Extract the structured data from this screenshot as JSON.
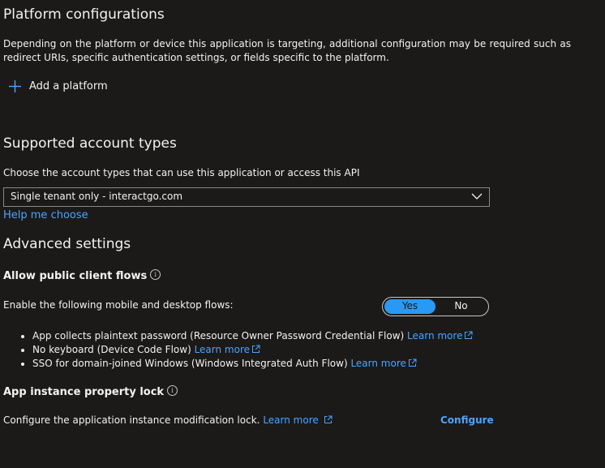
{
  "platform": {
    "title": "Platform configurations",
    "description": "Depending on the platform or device this application is targeting, additional configuration may be required such as redirect URIs, specific authentication settings, or fields specific to the platform.",
    "add_label": "Add a platform",
    "add_icon": "plus-icon"
  },
  "account_types": {
    "title": "Supported account types",
    "prompt": "Choose the account types that can use this application or access this API",
    "selected": "Single tenant only - interactgo.com",
    "help_link": "Help me choose"
  },
  "advanced": {
    "title": "Advanced settings",
    "public_client": {
      "label": "Allow public client flows",
      "prompt": "Enable the following mobile and desktop flows:",
      "toggle_yes": "Yes",
      "toggle_no": "No",
      "toggle_value": "Yes",
      "flows": [
        {
          "text": "App collects plaintext password (Resource Owner Password Credential Flow)",
          "link": "Learn more"
        },
        {
          "text": "No keyboard (Device Code Flow)",
          "link": "Learn more"
        },
        {
          "text": "SSO for domain-joined Windows (Windows Integrated Auth Flow)",
          "link": "Learn more"
        }
      ]
    },
    "property_lock": {
      "label": "App instance property lock",
      "text": "Configure the application instance modification lock.",
      "link": "Learn more",
      "configure": "Configure"
    }
  },
  "colors": {
    "background": "#1b1a19",
    "text": "#f3f2f1",
    "link": "#4da3ff",
    "toggle_on": "#2899f5"
  }
}
